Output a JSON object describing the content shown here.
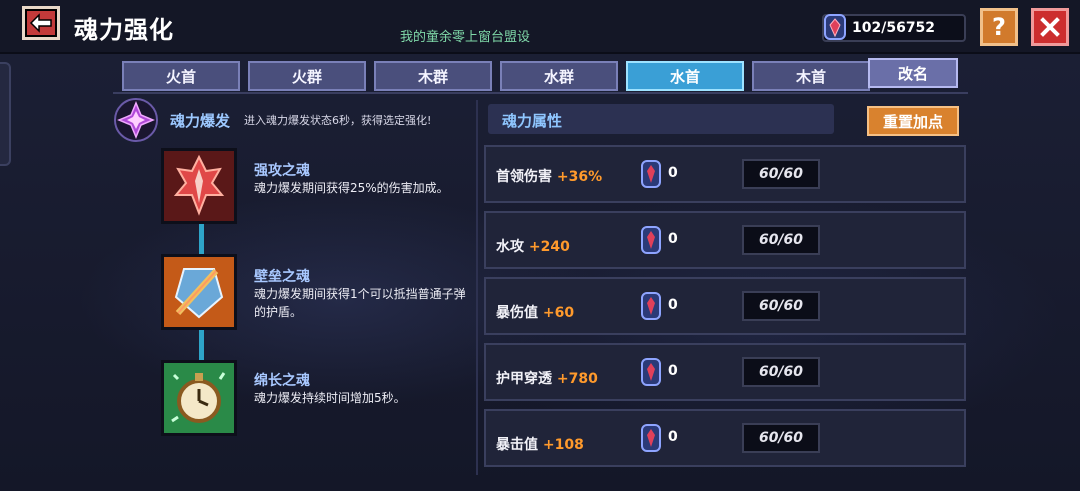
{
  "header": {
    "title": "魂力强化",
    "watermark": "我的童余零上窗台盟设",
    "currency": "102/56752",
    "help_label": "?"
  },
  "tabs": [
    {
      "label": "火首",
      "active": false
    },
    {
      "label": "火群",
      "active": false
    },
    {
      "label": "木群",
      "active": false
    },
    {
      "label": "水群",
      "active": false
    },
    {
      "label": "水首",
      "active": true
    },
    {
      "label": "木首",
      "active": false
    }
  ],
  "rename_label": "改名",
  "burst": {
    "title": "魂力爆发",
    "desc": "进入魂力爆发状态6秒，获得选定强化!"
  },
  "souls": [
    {
      "name": "强攻之魂",
      "desc": "魂力爆发期间获得25%的伤害加成。",
      "icon": "sword-soul-icon"
    },
    {
      "name": "壁垒之魂",
      "desc": "魂力爆发期间获得1个可以抵挡普通子弹的护盾。",
      "icon": "shield-soul-icon"
    },
    {
      "name": "绵长之魂",
      "desc": "魂力爆发持续时间增加5秒。",
      "icon": "clock-soul-icon"
    }
  ],
  "attributes": {
    "header": "魂力属性",
    "reset_label": "重置加点",
    "rows": [
      {
        "name": "首领伤害",
        "bonus": "+36%",
        "count": "0",
        "level": "60/60"
      },
      {
        "name": "水攻",
        "bonus": "+240",
        "count": "0",
        "level": "60/60"
      },
      {
        "name": "暴伤值",
        "bonus": "+60",
        "count": "0",
        "level": "60/60"
      },
      {
        "name": "护甲穿透",
        "bonus": "+780",
        "count": "0",
        "level": "60/60"
      },
      {
        "name": "暴击值",
        "bonus": "+108",
        "count": "0",
        "level": "60/60"
      }
    ]
  },
  "colors": {
    "accent_orange": "#ff9a2c",
    "active_tab": "#3a9fd6",
    "close_red": "#cc2e2e",
    "help_orange": "#d17a2c"
  }
}
